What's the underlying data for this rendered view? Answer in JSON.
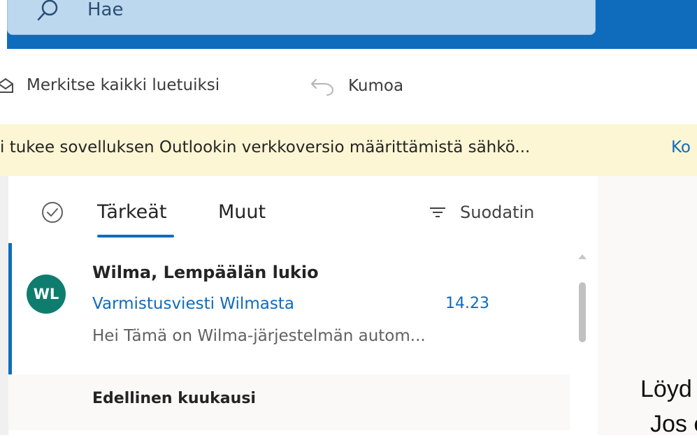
{
  "search": {
    "placeholder": "Hae"
  },
  "toolbar": {
    "mark_all_read_label": "Merkitse kaikki luetuiksi",
    "undo_label": "Kumoa"
  },
  "banner": {
    "text": "i tukee sovelluksen Outlookin verkkoversio määrittämistä sähkö...",
    "link": "Ko"
  },
  "inbox": {
    "tabs": [
      {
        "label": "Tärkeät",
        "active": true
      },
      {
        "label": "Muut",
        "active": false
      }
    ],
    "filter_label": "Suodatin",
    "messages": [
      {
        "avatar_initials": "WL",
        "avatar_color": "#0e7d6f",
        "sender": "Wilma, Lempäälän lukio",
        "subject": "Varmistusviesti Wilmasta",
        "time": "14.23",
        "preview": "Hei Tämä on Wilma-järjestelmän autom..."
      }
    ],
    "group_header": "Edellinen kuukausi"
  },
  "reading_pane": {
    "line1": "Löyd",
    "line2": "Jos e"
  },
  "colors": {
    "accent": "#0f6cbd",
    "banner_bg": "#fdf6d4"
  }
}
